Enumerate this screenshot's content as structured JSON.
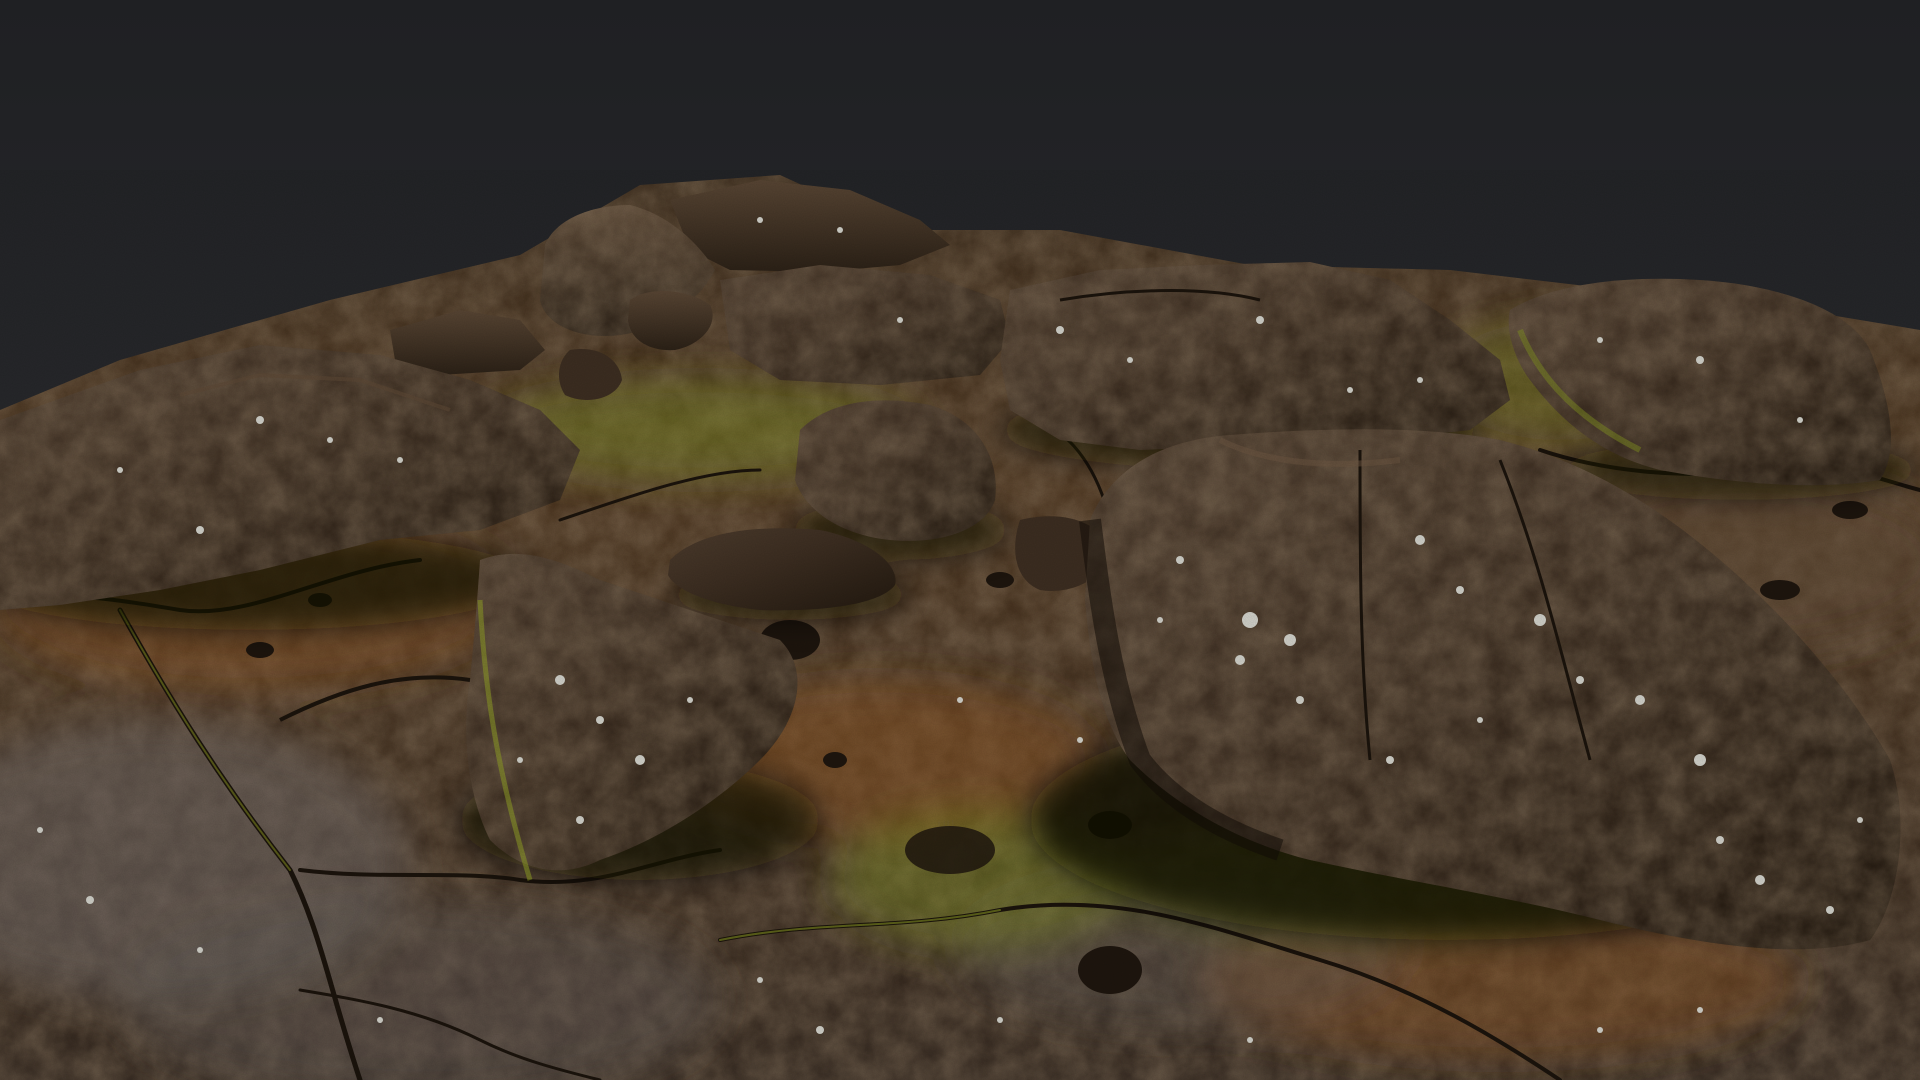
{
  "scene": {
    "subject": "rock-terrain-render",
    "colors": {
      "background": "#232427",
      "rock_dark": "#2b2118",
      "rock_mid": "#4e3822",
      "rock_rust": "#7a4a22",
      "rock_light": "#8a6a4a",
      "moss": "#6f7a1e",
      "moss_bright": "#8d9a24",
      "lichen": "#c9c9c2"
    }
  }
}
